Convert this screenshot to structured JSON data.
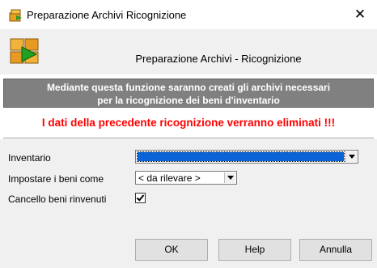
{
  "window": {
    "title": "Preparazione Archivi Ricognizione",
    "app_icon": "archive-box-icon",
    "close_glyph": "✕"
  },
  "header": {
    "title": "Preparazione Archivi - Ricognizione",
    "icon": "archive-boxes-arrow-icon"
  },
  "banner": {
    "line1": "Mediante questa funzione saranno creati gli archivi necessari",
    "line2": "per la ricognizione dei beni d'inventario"
  },
  "warning": {
    "text": "I dati della precedente ricognizione verranno eliminati !!!",
    "color": "#ff0000"
  },
  "form": {
    "inventario_label": "Inventario",
    "inventario_value": "",
    "impostare_label": "Impostare i beni come",
    "impostare_value": "< da rilevare >",
    "cancello_label": "Cancello beni rinvenuti",
    "cancello_checked": true
  },
  "buttons": {
    "ok": "OK",
    "help": "Help",
    "annulla": "Annulla"
  },
  "colors": {
    "banner_bg": "#808080",
    "selection": "#0a64d8",
    "panel_bg": "#f0f0f0"
  }
}
